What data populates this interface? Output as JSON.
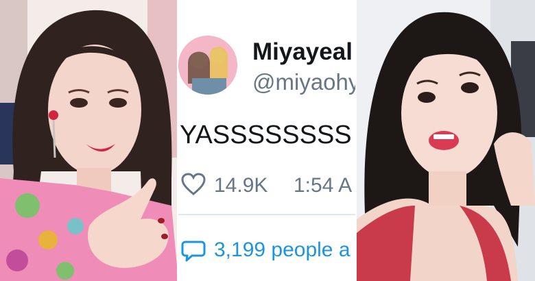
{
  "tweet": {
    "display_name": "Miyayeal",
    "handle": "@miyaohy",
    "text": "YASSSSSSSS",
    "like_count": "14.9K",
    "timestamp": "1:54 A",
    "people_text": "3,199 people a"
  },
  "colors": {
    "tweet_text": "#14171a",
    "muted_text": "#657786",
    "link_blue": "#1b95e0",
    "avatar_bg": "#f3b7c8"
  },
  "icons": {
    "like": "heart-icon",
    "reply": "speech-bubble-icon"
  }
}
